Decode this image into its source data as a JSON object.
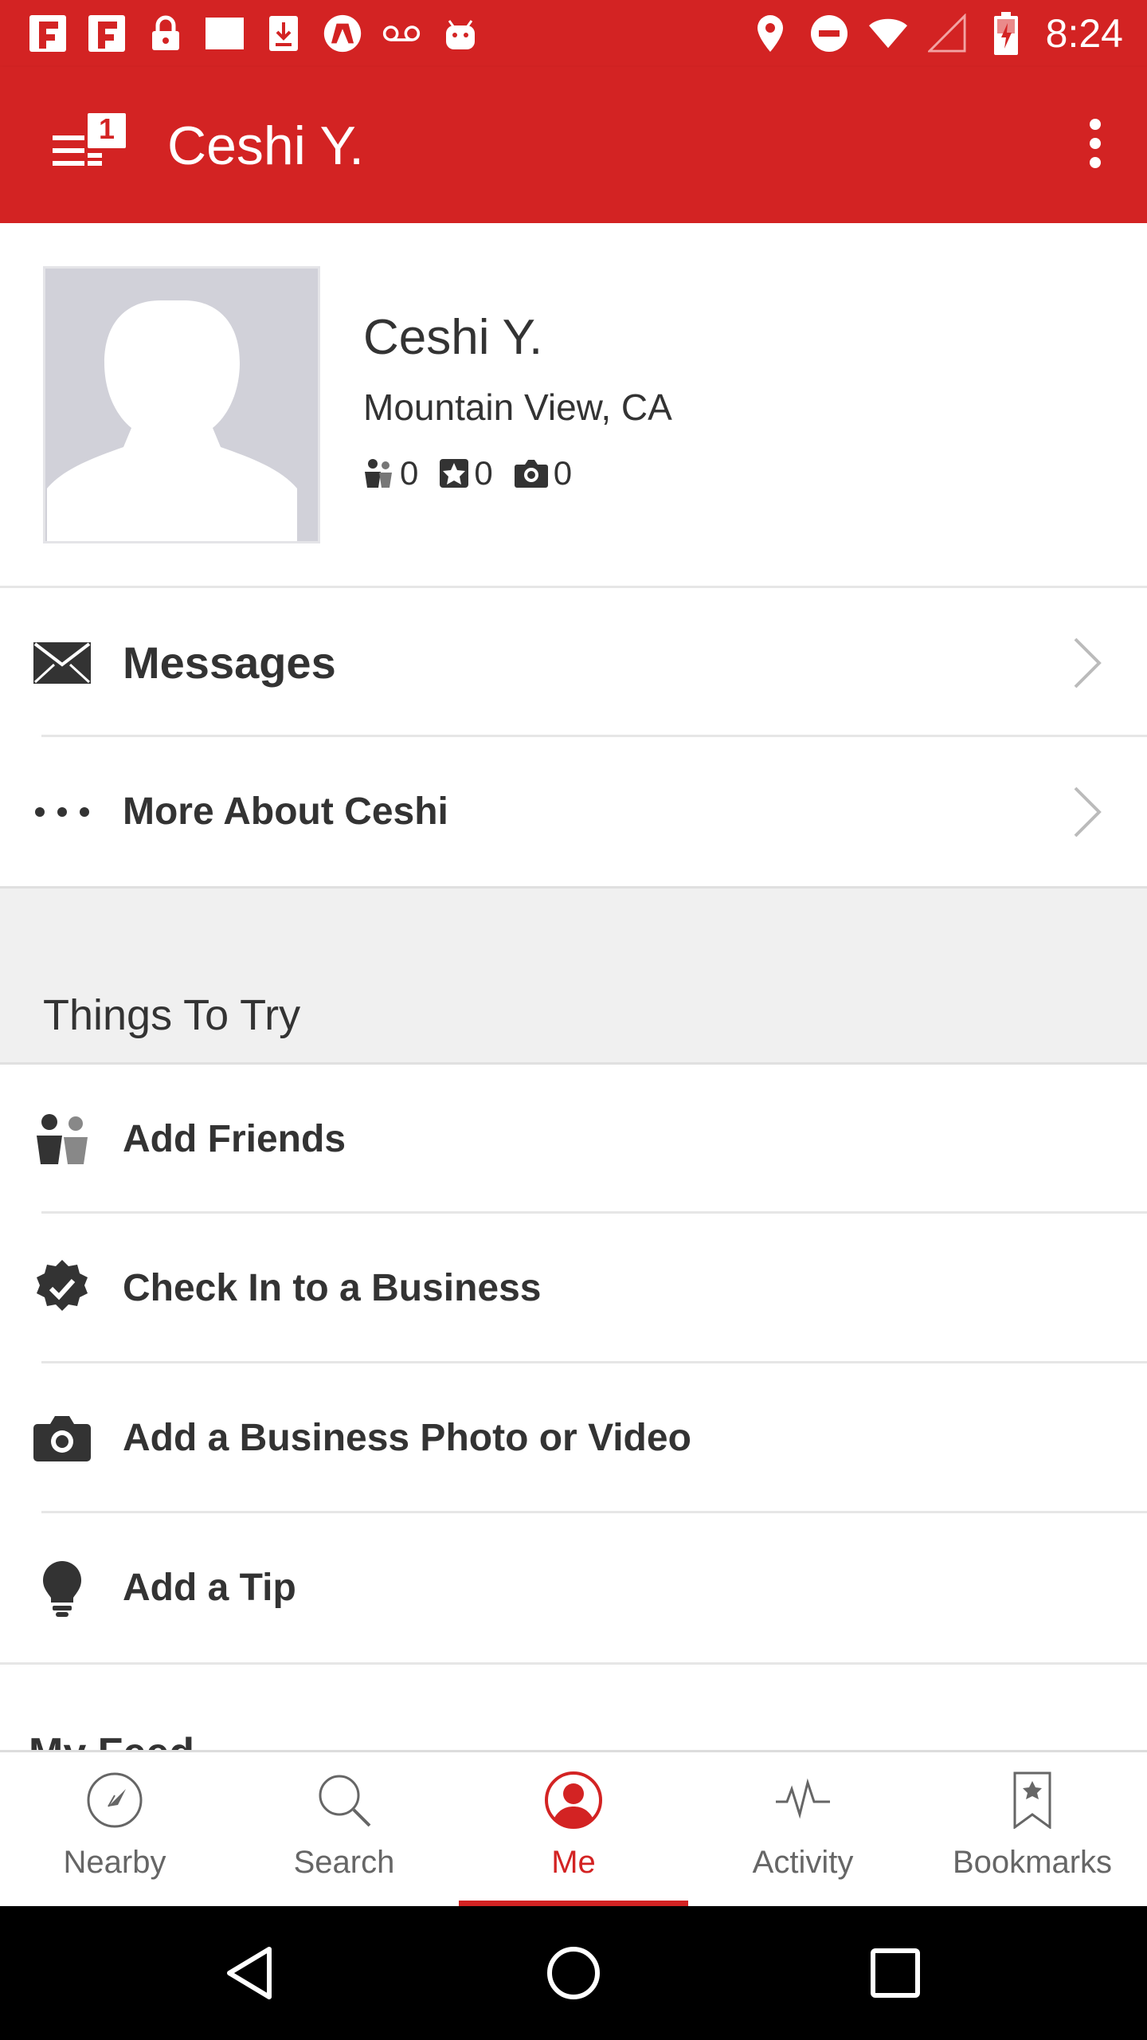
{
  "status_bar": {
    "time": "8:24",
    "left_icons": [
      "flipboard-icon",
      "flipboard-icon",
      "lock-icon",
      "square-icon",
      "download-icon",
      "android-icon",
      "voicemail-icon",
      "android-robot-icon"
    ],
    "right_icons": [
      "location-icon",
      "do-not-disturb-icon",
      "wifi-icon",
      "signal-icon",
      "battery-icon"
    ]
  },
  "app_bar": {
    "title": "Ceshi Y.",
    "badge_count": "1",
    "menu_icon": "drawer-menu-icon",
    "overflow_icon": "more-vert-icon"
  },
  "profile": {
    "name": "Ceshi Y.",
    "location": "Mountain View, CA",
    "friends_count": "0",
    "reviews_count": "0",
    "photos_count": "0"
  },
  "menu": {
    "messages": "Messages",
    "more_about": "More About Ceshi"
  },
  "things_to_try": {
    "title": "Things To Try",
    "items": [
      {
        "label": "Add Friends",
        "icon": "friends-icon"
      },
      {
        "label": "Check In to a Business",
        "icon": "check-in-icon"
      },
      {
        "label": "Add a Business Photo or Video",
        "icon": "camera-icon"
      },
      {
        "label": "Add a Tip",
        "icon": "lightbulb-icon"
      }
    ]
  },
  "next_section_peek": "My Feed",
  "bottom_nav": {
    "tabs": [
      {
        "label": "Nearby",
        "icon": "compass-icon",
        "active": false
      },
      {
        "label": "Search",
        "icon": "search-icon",
        "active": false
      },
      {
        "label": "Me",
        "icon": "profile-icon",
        "active": true
      },
      {
        "label": "Activity",
        "icon": "activity-icon",
        "active": false
      },
      {
        "label": "Bookmarks",
        "icon": "bookmark-icon",
        "active": false
      }
    ]
  },
  "colors": {
    "brand": "#d32323",
    "text": "#333333",
    "secondary": "#666666",
    "section_bg": "#f0f0f0"
  }
}
